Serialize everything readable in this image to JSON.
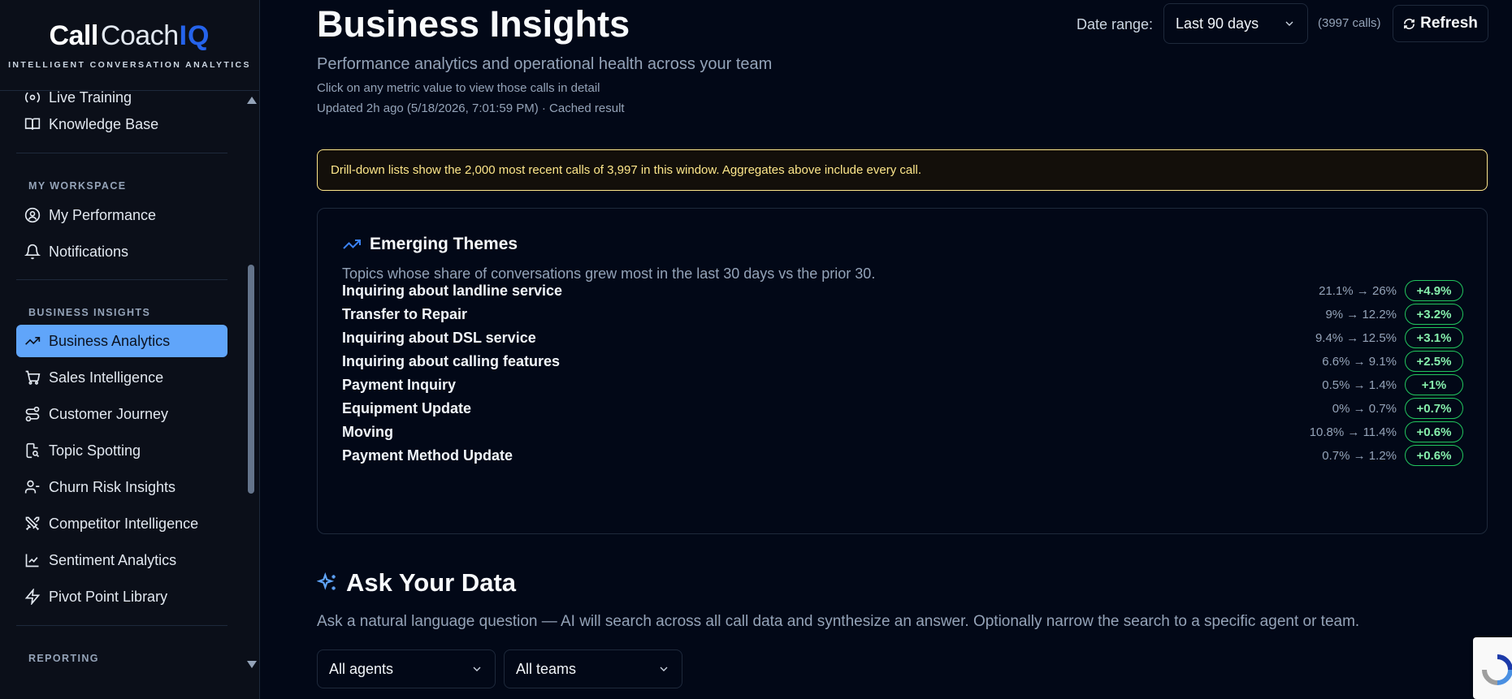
{
  "sidebar": {
    "brand": {
      "word1": "Call",
      "word2": "Coach",
      "word3": "IQ",
      "tagline": "INTELLIGENT CONVERSATION ANALYTICS"
    },
    "partial_item": "Live Training",
    "knowledge_base": "Knowledge Base",
    "sections": {
      "workspace": "MY WORKSPACE",
      "insights": "BUSINESS INSIGHTS",
      "reporting": "REPORTING"
    },
    "workspace_items": [
      "My Performance",
      "Notifications"
    ],
    "insights_items": [
      "Business Analytics",
      "Sales Intelligence",
      "Customer Journey",
      "Topic Spotting",
      "Churn Risk Insights",
      "Competitor Intelligence",
      "Sentiment Analytics",
      "Pivot Point Library"
    ],
    "accent_color": "#60a5fa"
  },
  "header": {
    "title": "Business Insights",
    "subtitle": "Performance analytics and operational health across your team",
    "hint": "Click on any metric value to view those calls in detail",
    "updated": "Updated 2h ago (5/18/2026, 7:01:59 PM) · Cached result",
    "date_label": "Date range:",
    "date_value": "Last 90 days",
    "calls_count": "(3997 calls)",
    "refresh_label": "Refresh"
  },
  "notice": {
    "text": "Drill-down lists show the 2,000 most recent calls of 3,997 in this window. Aggregates above include every call.",
    "color": "#fde68a"
  },
  "themes": {
    "title": "Emerging Themes",
    "description": "Topics whose share of conversations grew most in the last 30 days vs the prior 30.",
    "rows": [
      {
        "name": "Inquiring about landline service",
        "change": "21.1% → 26%",
        "delta": "+4.9%"
      },
      {
        "name": "Transfer to Repair",
        "change": "9% → 12.2%",
        "delta": "+3.2%"
      },
      {
        "name": "Inquiring about DSL service",
        "change": "9.4% → 12.5%",
        "delta": "+3.1%"
      },
      {
        "name": "Inquiring about calling features",
        "change": "6.6% → 9.1%",
        "delta": "+2.5%"
      },
      {
        "name": "Payment Inquiry",
        "change": "0.5% → 1.4%",
        "delta": "+1%"
      },
      {
        "name": "Equipment Update",
        "change": "0% → 0.7%",
        "delta": "+0.7%"
      },
      {
        "name": "Moving",
        "change": "10.8% → 11.4%",
        "delta": "+0.6%"
      },
      {
        "name": "Payment Method Update",
        "change": "0.7% → 1.2%",
        "delta": "+0.6%"
      }
    ],
    "badge_color": "#22c55e"
  },
  "ask": {
    "title": "Ask Your Data",
    "description": "Ask a natural language question — AI will search across all call data and synthesize an answer. Optionally narrow the search to a specific agent or team.",
    "agent_select": "All agents",
    "team_select": "All teams"
  }
}
